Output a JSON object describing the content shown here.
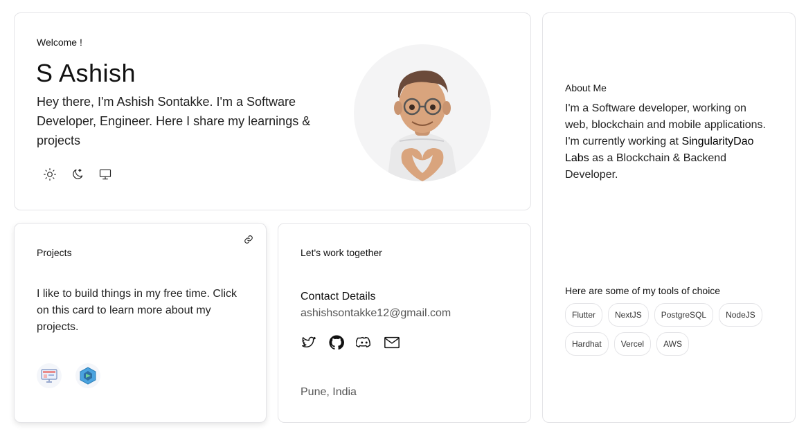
{
  "hero": {
    "welcome": "Welcome !",
    "name": "S Ashish",
    "intro": "Hey there, I'm Ashish Sontakke. I'm a Software Developer, Engineer. Here I share my learnings & projects",
    "theme_icons": [
      "sun-icon",
      "moon-icon",
      "monitor-icon"
    ]
  },
  "about": {
    "title": "About Me",
    "text_1": "I'm a Software developer, working on web, blockchain and mobile applications. I'm currently working at ",
    "company": "SingularityDao Labs",
    "text_2": " as a Blockchain & Backend Developer.",
    "tools_label": "Here are some of my tools of choice",
    "tools": [
      "Flutter",
      "NextJS",
      "PostgreSQL",
      "NodeJS",
      "Hardhat",
      "Vercel",
      "AWS"
    ]
  },
  "projects": {
    "title": "Projects",
    "text": "I like to build things in my free time. Click on this card to learn more about my projects.",
    "link_icon": "link-icon",
    "app_icons": [
      "screen-app-icon",
      "hexagon-app-icon"
    ]
  },
  "contact": {
    "title": "Let's work together",
    "details_label": "Contact Details",
    "email": "ashishsontakke12@gmail.com",
    "social_icons": [
      "twitter-icon",
      "github-icon",
      "discord-icon",
      "mail-icon"
    ],
    "location": "Pune, India"
  }
}
